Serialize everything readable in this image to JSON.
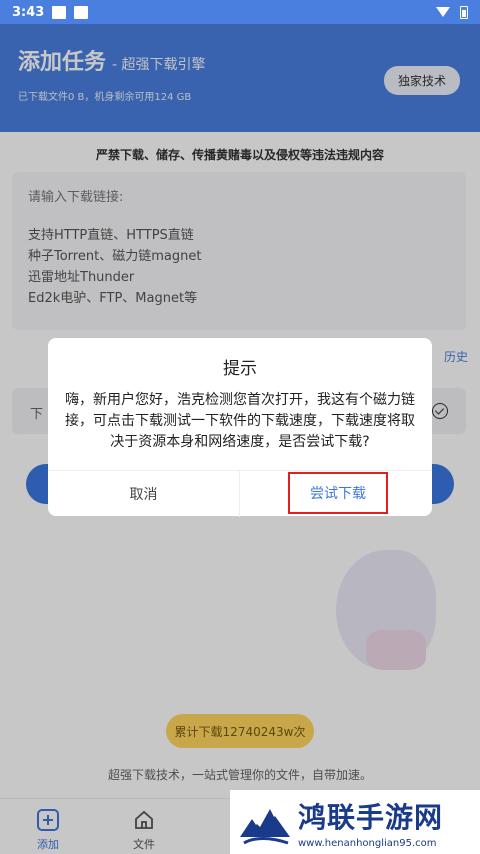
{
  "status_bar": {
    "time": "3:43"
  },
  "header": {
    "title": "添加任务",
    "subtitle": "- 超强下载引擎",
    "storage_info": "已下载文件0 B，机身剩余可用124 GB",
    "exclusive_button": "独家技术"
  },
  "warning": "严禁下载、储存、传播黄赌毒以及侵权等违法违规内容",
  "link_input": {
    "placeholder": "请输入下载链接:",
    "hints": [
      "支持HTTP直链、HTTPS直链",
      "种子Torrent、磁力链magnet",
      "迅雷地址Thunder",
      "Ed2k电驴、FTP、Magnet等"
    ]
  },
  "history_link": "历史",
  "download_row_label": "下",
  "download_count": "累计下载12740243w次",
  "tagline": "超强下载技术，一站式管理你的文件，自带加速。",
  "bottom_nav": [
    {
      "label": "添加",
      "icon": "add-icon"
    },
    {
      "label": "文件",
      "icon": "home-icon"
    }
  ],
  "dialog": {
    "title": "提示",
    "message": "嗨，新用户您好，浩克检测您首次打开，我这有个磁力链接，可点击下载测试一下软件的下载速度，下载速度将取决于资源本身和网络速度，是否尝试下载?",
    "cancel_label": "取消",
    "confirm_label": "尝试下载"
  },
  "watermark": {
    "title": "鸿联手游网",
    "url": "www.henanhonglian95.com"
  },
  "colors": {
    "brand": "#4a7fe0",
    "highlight_border": "#e02020",
    "count_pill": "#ffd75e"
  }
}
